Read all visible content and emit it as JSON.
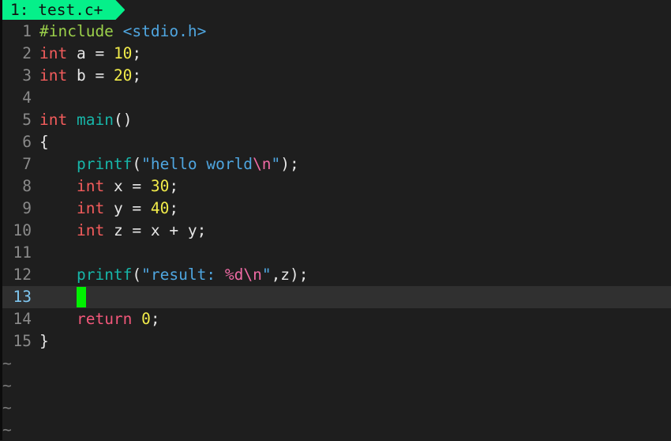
{
  "tabline": {
    "tabs": [
      {
        "index": "1:",
        "name": "test.c+",
        "active": true
      }
    ],
    "accent": "#05f08a"
  },
  "editor": {
    "current_line": 13,
    "lines": [
      {
        "num": "1",
        "tokens": [
          {
            "t": "pp",
            "v": "#include"
          },
          {
            "t": "code",
            "v": " "
          },
          {
            "t": "inc",
            "v": "<stdio.h>"
          }
        ]
      },
      {
        "num": "2",
        "tokens": [
          {
            "t": "kw",
            "v": "int"
          },
          {
            "t": "code",
            "v": " a = "
          },
          {
            "t": "num",
            "v": "10"
          },
          {
            "t": "code",
            "v": ";"
          }
        ]
      },
      {
        "num": "3",
        "tokens": [
          {
            "t": "kw",
            "v": "int"
          },
          {
            "t": "code",
            "v": " b = "
          },
          {
            "t": "num",
            "v": "20"
          },
          {
            "t": "code",
            "v": ";"
          }
        ]
      },
      {
        "num": "4",
        "tokens": []
      },
      {
        "num": "5",
        "tokens": [
          {
            "t": "kw",
            "v": "int"
          },
          {
            "t": "code",
            "v": " "
          },
          {
            "t": "fn",
            "v": "main"
          },
          {
            "t": "code",
            "v": "()"
          }
        ]
      },
      {
        "num": "6",
        "tokens": [
          {
            "t": "code",
            "v": "{"
          }
        ]
      },
      {
        "num": "7",
        "tokens": [
          {
            "t": "code",
            "v": "    "
          },
          {
            "t": "fn",
            "v": "printf"
          },
          {
            "t": "code",
            "v": "("
          },
          {
            "t": "str",
            "v": "\"hello world"
          },
          {
            "t": "esc",
            "v": "\\n"
          },
          {
            "t": "str",
            "v": "\""
          },
          {
            "t": "code",
            "v": ");"
          }
        ]
      },
      {
        "num": "8",
        "tokens": [
          {
            "t": "code",
            "v": "    "
          },
          {
            "t": "kw",
            "v": "int"
          },
          {
            "t": "code",
            "v": " x = "
          },
          {
            "t": "num",
            "v": "30"
          },
          {
            "t": "code",
            "v": ";"
          }
        ]
      },
      {
        "num": "9",
        "tokens": [
          {
            "t": "code",
            "v": "    "
          },
          {
            "t": "kw",
            "v": "int"
          },
          {
            "t": "code",
            "v": " y = "
          },
          {
            "t": "num",
            "v": "40"
          },
          {
            "t": "code",
            "v": ";"
          }
        ]
      },
      {
        "num": "10",
        "tokens": [
          {
            "t": "code",
            "v": "    "
          },
          {
            "t": "kw",
            "v": "int"
          },
          {
            "t": "code",
            "v": " z = x + y;"
          }
        ]
      },
      {
        "num": "11",
        "tokens": []
      },
      {
        "num": "12",
        "tokens": [
          {
            "t": "code",
            "v": "    "
          },
          {
            "t": "fn",
            "v": "printf"
          },
          {
            "t": "code",
            "v": "("
          },
          {
            "t": "str",
            "v": "\"result: "
          },
          {
            "t": "esc",
            "v": "%d\\n"
          },
          {
            "t": "str",
            "v": "\""
          },
          {
            "t": "code",
            "v": ",z);"
          }
        ]
      },
      {
        "num": "13",
        "tokens": [
          {
            "t": "code",
            "v": "    "
          },
          {
            "t": "cursor",
            "v": ""
          }
        ]
      },
      {
        "num": "14",
        "tokens": [
          {
            "t": "code",
            "v": "    "
          },
          {
            "t": "ret",
            "v": "return"
          },
          {
            "t": "code",
            "v": " "
          },
          {
            "t": "num",
            "v": "0"
          },
          {
            "t": "code",
            "v": ";"
          }
        ]
      },
      {
        "num": "15",
        "tokens": [
          {
            "t": "code",
            "v": "}"
          }
        ]
      }
    ],
    "empty_line_marker": "~",
    "empty_line_count": 4
  }
}
